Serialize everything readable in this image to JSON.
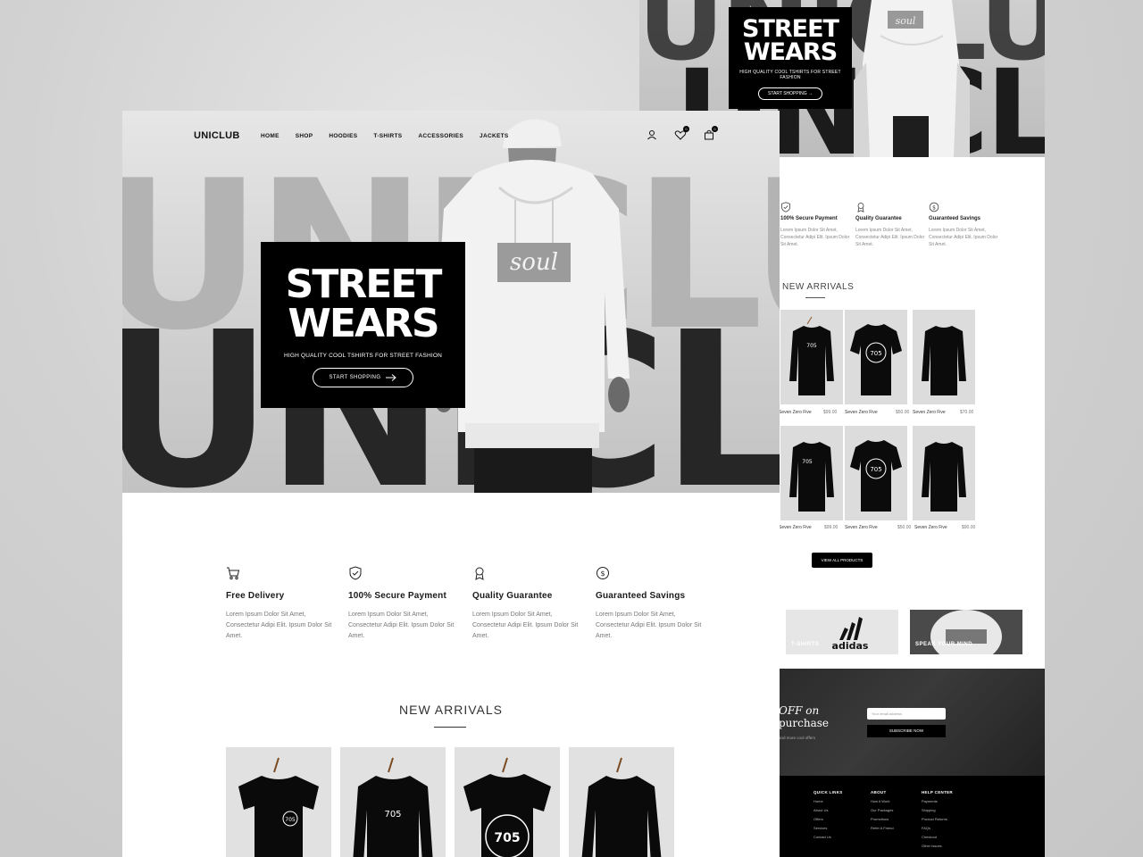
{
  "back": {
    "hero": {
      "bg_word": "UNICLUB",
      "title1": "STREET",
      "title2": "WEARS",
      "subtitle": "HIGH QUALITY COOL TSHIRTS FOR STREET FASHION",
      "cta": "START SHOPPING →"
    },
    "features": [
      {
        "title": "100% Secure Payment",
        "desc": "Lorem Ipsum Dolor Sit Amet, Consectetur Adipi Elit. Ipsum Dolor Sit Amet."
      },
      {
        "title": "Quality Guarantee",
        "desc": "Lorem Ipsum Dolor Sit Amet, Consectetur Adipi Elit. Ipsum Dolor Sit Amet."
      },
      {
        "title": "Guaranteed Savings",
        "desc": "Lorem Ipsum Dolor Sit Amet, Consectetur Adipi Elit. Ipsum Dolor Sit Amet."
      }
    ],
    "section_title": "NEW ARRIVALS",
    "products": [
      {
        "name": "Seven Zero Five",
        "price": "$99.00"
      },
      {
        "name": "Seven Zero Five",
        "price": "$50.00"
      },
      {
        "name": "Seven Zero Five",
        "price": "$70.00"
      },
      {
        "name": "Seven Zero Five",
        "price": "$99.00"
      },
      {
        "name": "Seven Zero Five",
        "price": "$50.00"
      },
      {
        "name": "Seven Zero Five",
        "price": "$90.00"
      }
    ],
    "view_all": "VIEW ALL PRODUCTS",
    "categories": [
      {
        "label": "T-SHIRTS"
      },
      {
        "label": "SPEAK YOUR MIND"
      }
    ],
    "promo": {
      "line1": "OFF on",
      "line2": "purchase",
      "line3": "and more cool offers",
      "email_placeholder": "Your email address",
      "subscribe": "SUBSCRIBE NOW"
    },
    "footer": {
      "cols": [
        {
          "head": "QUICK LINKS",
          "items": [
            "Home",
            "About Us",
            "Offers",
            "Services",
            "Contact Us"
          ]
        },
        {
          "head": "ABOUT",
          "items": [
            "How it Work",
            "Our Packages",
            "Promotions",
            "Refer A Friend"
          ]
        },
        {
          "head": "HELP CENTER",
          "items": [
            "Payments",
            "Shipping",
            "Product Returns",
            "FAQs",
            "Checkout",
            "Other Issues"
          ]
        }
      ]
    }
  },
  "front": {
    "logo": "UNICLUB",
    "nav": [
      "HOME",
      "SHOP",
      "HOODIES",
      "T-SHIRTS",
      "ACCESSORIES",
      "JACKETS"
    ],
    "wishlist_count": "0",
    "cart_count": "0",
    "hero": {
      "bg_word": "UNICLUB",
      "hoodie_text": "soul",
      "title1": "STREET",
      "title2": "WEARS",
      "subtitle": "HIGH QUALITY COOL TSHIRTS FOR STREET FASHION",
      "cta": "START SHOPPING"
    },
    "features": [
      {
        "title": "Free Delivery",
        "desc": "Lorem Ipsum Dolor Sit Amet, Consectetur Adipi Elit. Ipsum Dolor Sit Amet."
      },
      {
        "title": "100% Secure Payment",
        "desc": "Lorem Ipsum Dolor Sit Amet, Consectetur Adipi Elit. Ipsum Dolor Sit Amet."
      },
      {
        "title": "Quality Guarantee",
        "desc": "Lorem Ipsum Dolor Sit Amet, Consectetur Adipi Elit. Ipsum Dolor Sit Amet."
      },
      {
        "title": "Guaranteed Savings",
        "desc": "Lorem Ipsum Dolor Sit Amet, Consectetur Adipi Elit. Ipsum Dolor Sit Amet."
      }
    ],
    "section_title": "NEW ARRIVALS",
    "shirt_print": "705"
  },
  "colors": {
    "black": "#000000",
    "white": "#ffffff",
    "backdrop": "#cdcdcd"
  }
}
